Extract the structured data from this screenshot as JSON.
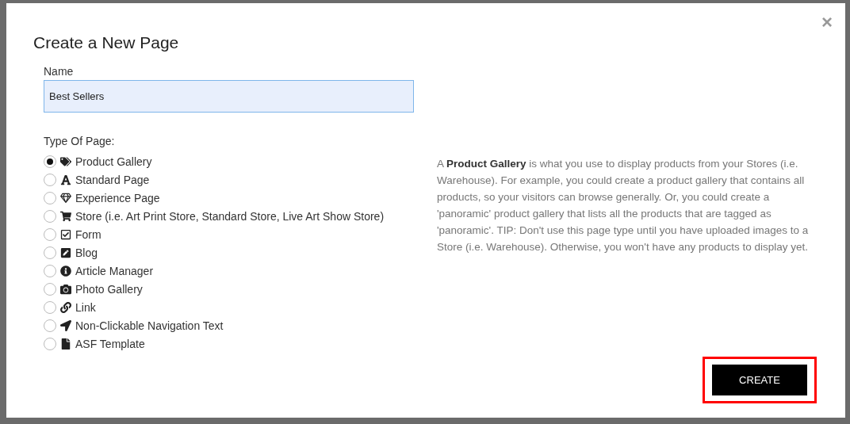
{
  "dialog": {
    "title": "Create a New Page",
    "close": "×"
  },
  "name_field": {
    "label": "Name",
    "value": "Best Sellers"
  },
  "page_type": {
    "label": "Type Of Page:",
    "options": [
      {
        "label": "Product Gallery",
        "selected": true
      },
      {
        "label": "Standard Page",
        "selected": false
      },
      {
        "label": "Experience Page",
        "selected": false
      },
      {
        "label": "Store (i.e. Art Print Store, Standard Store, Live Art Show Store)",
        "selected": false
      },
      {
        "label": "Form",
        "selected": false
      },
      {
        "label": "Blog",
        "selected": false
      },
      {
        "label": "Article Manager",
        "selected": false
      },
      {
        "label": "Photo Gallery",
        "selected": false
      },
      {
        "label": "Link",
        "selected": false
      },
      {
        "label": "Non-Clickable Navigation Text",
        "selected": false
      },
      {
        "label": "ASF Template",
        "selected": false
      }
    ]
  },
  "description": "A **Product Gallery** is what you use to display products from your Stores (i.e. Warehouse). For example, you could create a product gallery that contains all products, so your visitors can browse generally. Or, you could create a 'panoramic' product gallery that lists all the products that are tagged as 'panoramic'. TIP: Don't use this page type until you have uploaded images to a Store (i.e. Warehouse). Otherwise, you won't have any products to display yet.",
  "create_button": {
    "label": "CREATE",
    "highlighted": true
  }
}
